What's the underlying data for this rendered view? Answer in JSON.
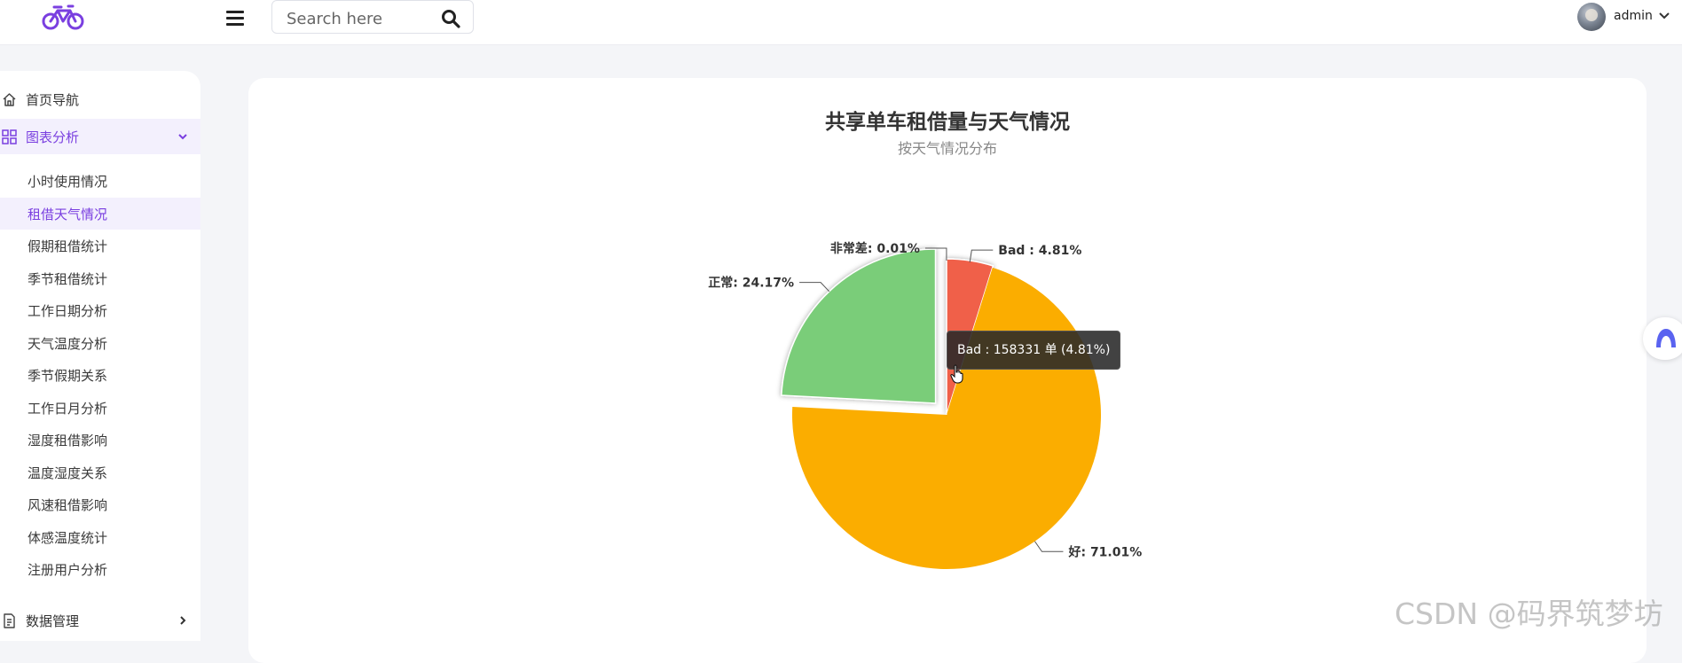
{
  "header": {
    "search_placeholder": "Search here",
    "user_name": "admin"
  },
  "sidebar": {
    "items": [
      {
        "label": "首页导航",
        "icon": "home-icon"
      },
      {
        "label": "图表分析",
        "icon": "grid-icon",
        "expanded": true
      },
      {
        "label": "数据管理",
        "icon": "document-icon"
      }
    ],
    "chart_submenu": [
      "小时使用情况",
      "租借天气情况",
      "假期租借统计",
      "季节租借统计",
      "工作日期分析",
      "天气温度分析",
      "季节假期关系",
      "工作日月分析",
      "湿度租借影响",
      "温度湿度关系",
      "风速租借影响",
      "体感温度统计",
      "注册用户分析"
    ],
    "selected_submenu": "租借天气情况"
  },
  "chart_data": {
    "type": "pie",
    "title": "共享单车租借量与天气情况",
    "subtitle": "按天气情况分布",
    "slices": [
      {
        "name": "Bad",
        "percent": 4.81,
        "label": "Bad : 4.81%",
        "color": "#f0614a"
      },
      {
        "name": "好",
        "percent": 71.01,
        "label": "好: 71.01%",
        "color": "#fbad00"
      },
      {
        "name": "正常",
        "percent": 24.17,
        "label": "正常: 24.17%",
        "color": "#7acd79"
      },
      {
        "name": "非常差",
        "percent": 0.01,
        "label": "非常差: 0.01%",
        "color": "#5470c6"
      }
    ],
    "tooltip": "Bad : 158331 单 (4.81%)"
  },
  "colors": {
    "accent": "#7a3fe0",
    "sidebar_active_bg": "#f3f0fd"
  },
  "watermark": "CSDN @码界筑梦坊"
}
